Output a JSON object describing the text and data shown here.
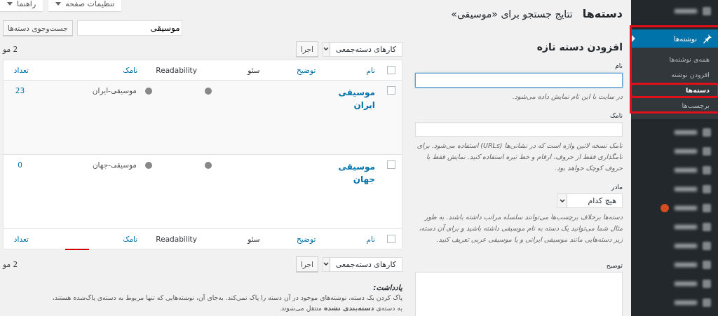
{
  "screen_options": [
    {
      "label": "تنظیمات صفحه"
    },
    {
      "label": "راهنما"
    }
  ],
  "header": {
    "title": "دسته‌ها",
    "subtitle": "تتایج جستجو برای «موسیقی»"
  },
  "search": {
    "value": "موسیقی",
    "button": "جست‌وجوی دسته‌ها"
  },
  "add_form": {
    "heading": "افزودن دسته تازه",
    "fields": [
      {
        "kind": "text",
        "label": "نام",
        "focused": true,
        "help": "در سایت با این نام نمایش داده می‌شود."
      },
      {
        "kind": "text",
        "label": "نامک",
        "focused": false,
        "help": "نامک نسخه لاتین واژه است که در نشانی‌ها (URLs) استفاده می‌شود. برای نامگذاری فقط از حروف، ارقام و خط تیره استفاده کنید. نمایش فقط با حروف کوچک خواهد بود."
      },
      {
        "kind": "select",
        "label": "مادر",
        "value": "هیچ کدام",
        "help": "دسته‌ها برخلاف برچسب‌ها می‌توانند سلسله مراتب داشته باشند. به طور مثال شما می‌توانید یک دسته به نام موسیقی داشته باشید و برای آن دسته، زیر دسته‌هایی مانند موسیقی ایرانی و یا موسیقی عربی تعریف کنید."
      },
      {
        "kind": "textarea",
        "label": "توضیح"
      }
    ]
  },
  "bulk_top": {
    "select": "کارهای دسته‌جمعی",
    "apply": "اجرا",
    "count": "2 مو"
  },
  "table": {
    "header_checked": false,
    "footer_checked": false,
    "columns": [
      {
        "label": "نام",
        "link": true
      },
      {
        "label": "توضیح",
        "link": true
      },
      {
        "label": "سئو",
        "link": false
      },
      {
        "label": "Readability",
        "link": false
      },
      {
        "label": "نامک",
        "link": true
      },
      {
        "label": "تعداد",
        "link": true
      }
    ],
    "footer_columns": [
      {
        "label": "نام",
        "link": true
      },
      {
        "label": "توضیح",
        "link": true
      },
      {
        "label": "سئو",
        "link": false
      },
      {
        "label": "Readability",
        "link": false
      },
      {
        "label": "نامک",
        "link": true
      },
      {
        "label": "تعداد",
        "link": true
      }
    ],
    "rows": [
      {
        "checked": false,
        "name": "موسیقی ایران",
        "slug": "موسیقی-ایران",
        "count": "23"
      },
      {
        "checked": false,
        "name": "موسیقی جهان",
        "slug": "موسیقی-جهان",
        "count": "0"
      }
    ]
  },
  "bulk_bottom": {
    "select": "کارهای دسته‌جمعی",
    "apply": "اجرا",
    "count": "2 مو"
  },
  "note": {
    "title": "یادداشت:",
    "lines": [
      "پاک کردن یک دسته، نوشته‌های موجود در آن دسته را پاک نمی‌کند. به‌جای آن، نوشته‌هایی که تنها مربوط به دسته‌ی پاک‌شده هستند،",
      "به دسته‌ی **دسته‌بندی نشده** منتقل می‌شوند."
    ]
  },
  "sidebar": {
    "items": [
      {
        "kind": "blurred",
        "badge": false
      },
      {
        "kind": "active",
        "label": "نوشته‌ها",
        "highlighted": true,
        "children": [
          {
            "label": "همه‌ی نوشته‌ها",
            "selected": false,
            "highlighted": false
          },
          {
            "label": "افزودن نوشته",
            "selected": false,
            "highlighted": false
          },
          {
            "label": "دسته‌ها",
            "selected": true,
            "highlighted": true
          },
          {
            "label": "برچسب‌ها",
            "selected": false,
            "highlighted": false
          }
        ]
      },
      {
        "kind": "blurred",
        "badge": false
      },
      {
        "kind": "blurred",
        "badge": false
      },
      {
        "kind": "blurred",
        "badge": false
      },
      {
        "kind": "blurred",
        "badge": false
      },
      {
        "kind": "blurred",
        "badge": true
      },
      {
        "kind": "blurred",
        "badge": false
      },
      {
        "kind": "blurred",
        "badge": false
      },
      {
        "kind": "blurred",
        "badge": false
      },
      {
        "kind": "blurred",
        "badge": false
      },
      {
        "kind": "blurred",
        "badge": false
      }
    ]
  }
}
